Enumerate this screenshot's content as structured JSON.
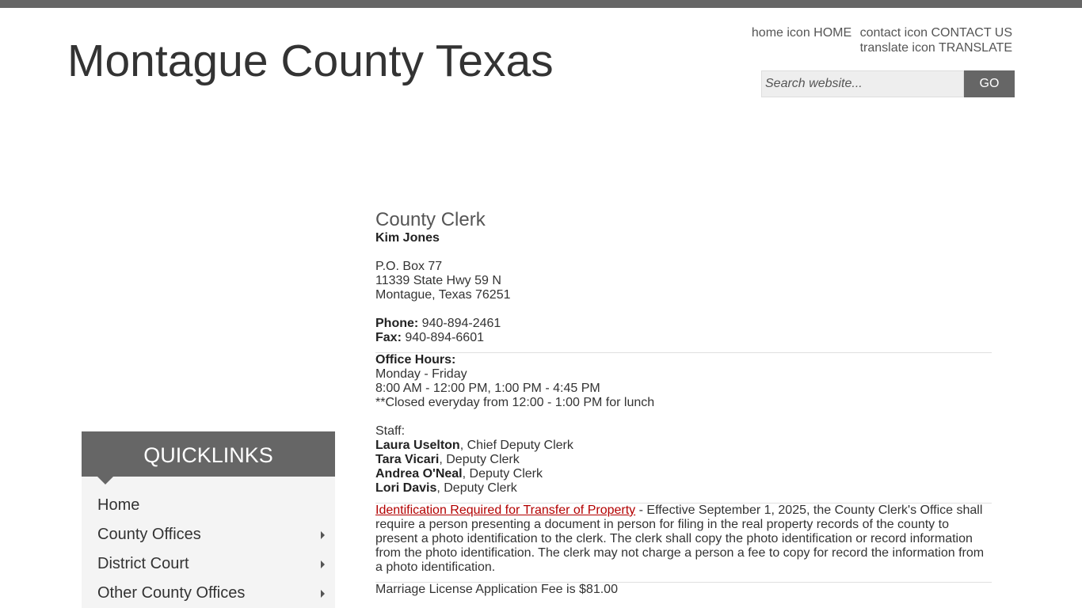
{
  "site": {
    "title": "Montague County Texas"
  },
  "utility_nav": {
    "home": {
      "icon_alt": "home icon",
      "label": "HOME"
    },
    "contact": {
      "icon_alt": "contact icon",
      "label": "CONTACT US"
    },
    "translate": {
      "icon_alt": "translate icon",
      "label": "TRANSLATE"
    }
  },
  "search": {
    "placeholder": "Search website...",
    "button_label": "GO"
  },
  "quicklinks": {
    "title": "QUICKLINKS",
    "items": [
      {
        "label": "Home",
        "has_submenu": false
      },
      {
        "label": "County Offices",
        "has_submenu": true
      },
      {
        "label": "District Court",
        "has_submenu": true
      },
      {
        "label": "Other County Offices",
        "has_submenu": true
      }
    ]
  },
  "content": {
    "heading": "County Clerk",
    "official_name": "Kim Jones",
    "address": [
      "P.O. Box 77",
      "11339 State Hwy 59 N",
      "Montague, Texas 76251"
    ],
    "phone_label": "Phone:",
    "phone": " 940-894-2461",
    "fax_label": "Fax:",
    "fax": " 940-894-6601",
    "hours_label": "Office Hours:",
    "hours": [
      "Monday - Friday",
      "8:00 AM - 12:00 PM, 1:00 PM - 4:45 PM",
      "**Closed everyday from 12:00 - 1:00 PM for lunch"
    ],
    "staff_label": "Staff:",
    "staff": [
      {
        "name": "Laura Uselton",
        "title": ", Chief Deputy Clerk"
      },
      {
        "name": "Tara Vicari",
        "title": ", Deputy Clerk"
      },
      {
        "name": "Andrea O'Neal",
        "title": ", Deputy Clerk"
      },
      {
        "name": "Lori Davis",
        "title": ", Deputy Clerk"
      }
    ],
    "notice_link": "Identification Required for Transfer of Property",
    "notice_text": " - Effective September 1, 2025, the County Clerk's Office shall require a person presenting a document in person for filing in the real property records of the county to present a photo identification to the clerk. The clerk shall copy the photo identification or record information from the photo identification. The clerk may not charge a person a fee to copy for record the information from a photo identification.",
    "fee_line": "Marriage License Application Fee is $81.00"
  },
  "colors": {
    "header_gray": "#666666",
    "link_red": "#b30000",
    "text": "#333333"
  }
}
